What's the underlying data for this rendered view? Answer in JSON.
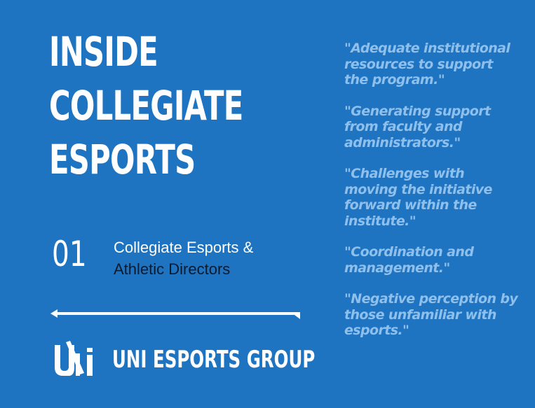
{
  "title_lines": [
    "INSIDE",
    "COLLEGIATE",
    "ESPORTS"
  ],
  "section": {
    "number": "01",
    "line1": "Collegiate Esports &",
    "line2": "Athletic Directors"
  },
  "brand": {
    "logo_text": "UNI",
    "logo_icon": "uni-logo-icon",
    "name": "UNI ESPORTS GROUP"
  },
  "quotes": [
    "\"Adequate institutional resources to support the program.\"",
    "\"Generating support from faculty and administrators.\"",
    "\"Challenges with moving the initiative forward within the institute.\"",
    "\"Coordination and management.\"",
    "\"Negative perception by those unfamiliar with esports.\""
  ],
  "colors": {
    "background": "#1f74c2",
    "title": "#ffffff",
    "quote_text": "#8fc0ec",
    "dark_text": "#0b1a2c"
  }
}
